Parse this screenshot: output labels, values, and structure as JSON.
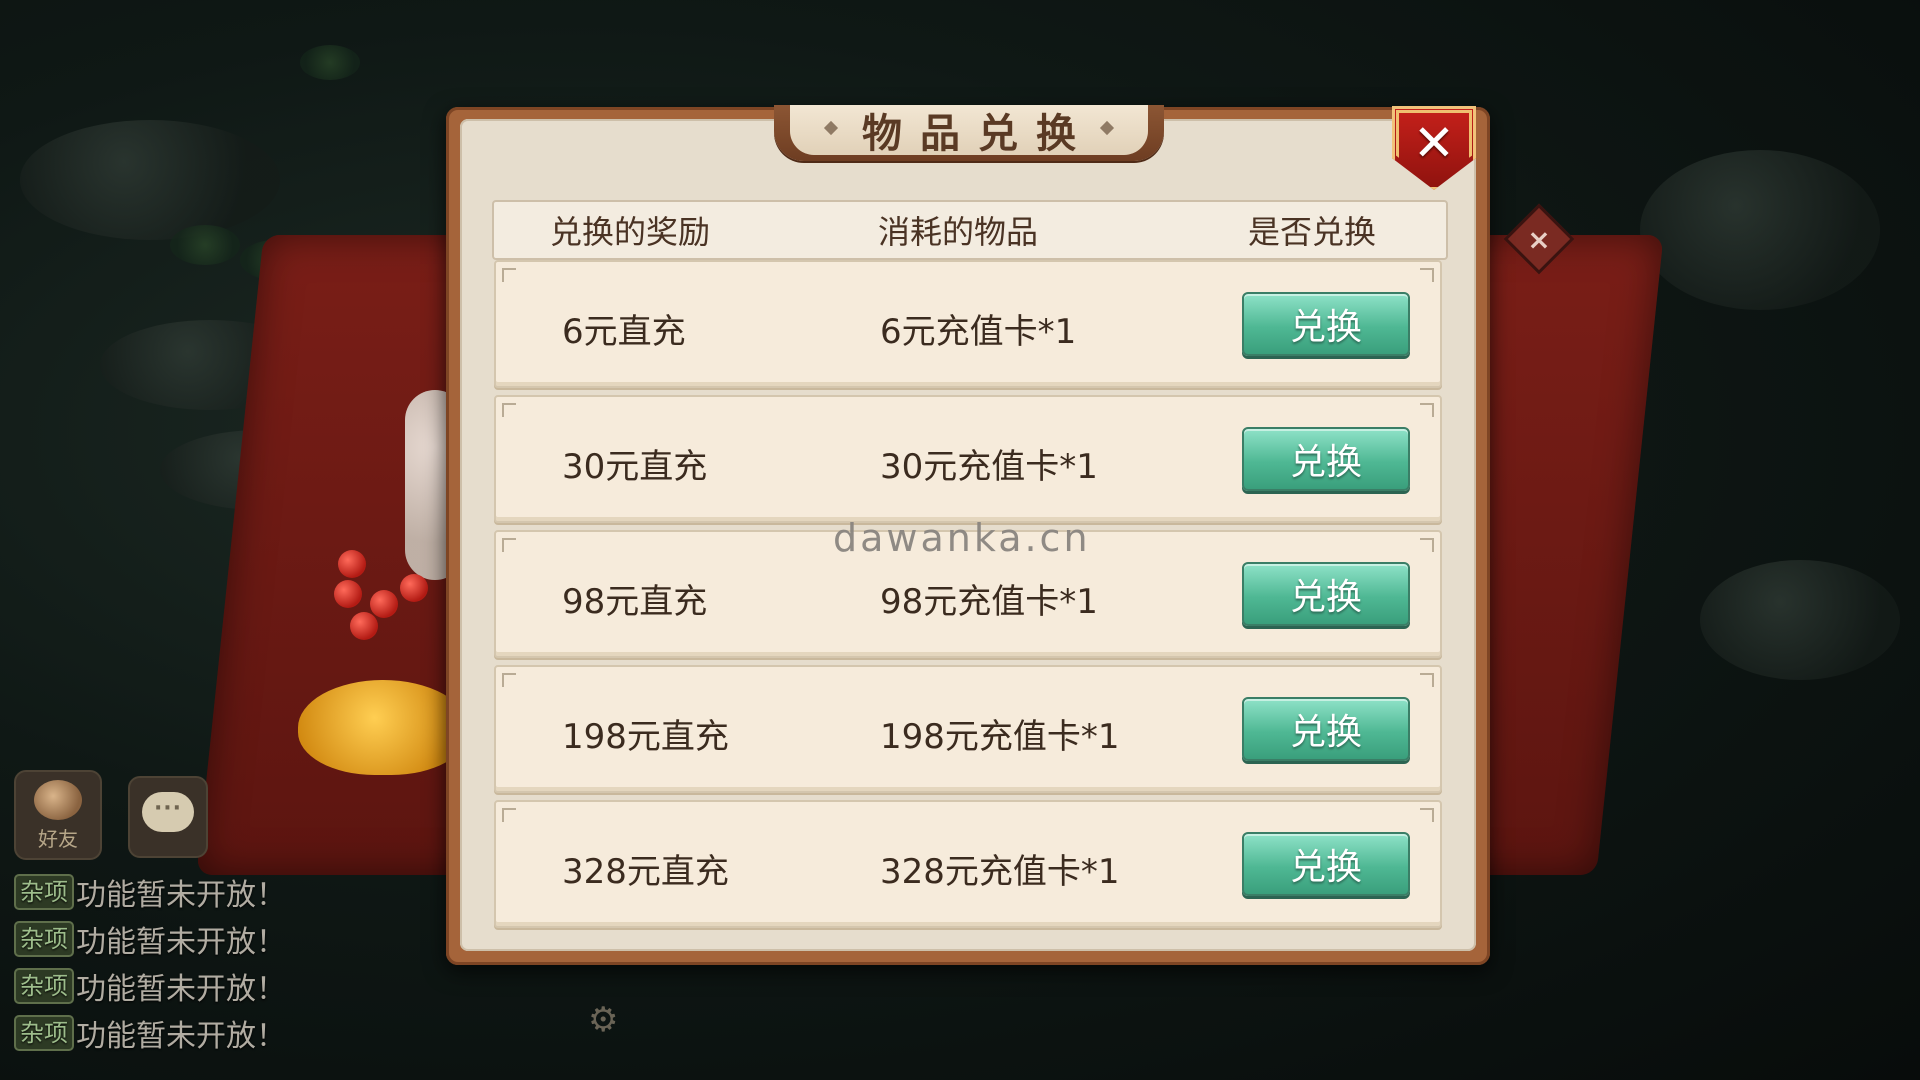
{
  "dialog": {
    "title": "物品兑换",
    "close_label": "✕",
    "columns": [
      "兑换的奖励",
      "消耗的物品",
      "是否兑换"
    ],
    "rows": [
      {
        "reward": "6元直充",
        "cost": "6元充值卡*1",
        "action": "兑换"
      },
      {
        "reward": "30元直充",
        "cost": "30元充值卡*1",
        "action": "兑换"
      },
      {
        "reward": "98元直充",
        "cost": "98元充值卡*1",
        "action": "兑换"
      },
      {
        "reward": "198元直充",
        "cost": "198元充值卡*1",
        "action": "兑换"
      },
      {
        "reward": "328元直充",
        "cost": "328元充值卡*1",
        "action": "兑换"
      }
    ]
  },
  "watermark": "dawanka.cn",
  "hud": {
    "friend_label": "好友",
    "messages": [
      {
        "tag": "杂项",
        "text": "功能暂未开放！"
      },
      {
        "tag": "杂项",
        "text": "功能暂未开放！"
      },
      {
        "tag": "杂项",
        "text": "功能暂未开放！"
      },
      {
        "tag": "杂项",
        "text": "功能暂未开放！"
      }
    ]
  },
  "icons": {
    "close": "close-icon",
    "side_close": "diamond-close-icon",
    "friend": "handshake-icon",
    "chat": "chat-bubble-icon",
    "settings": "gear-icon"
  },
  "colors": {
    "button_green": "#4fb894",
    "frame_brown": "#a5643a",
    "close_red": "#c7211b"
  }
}
